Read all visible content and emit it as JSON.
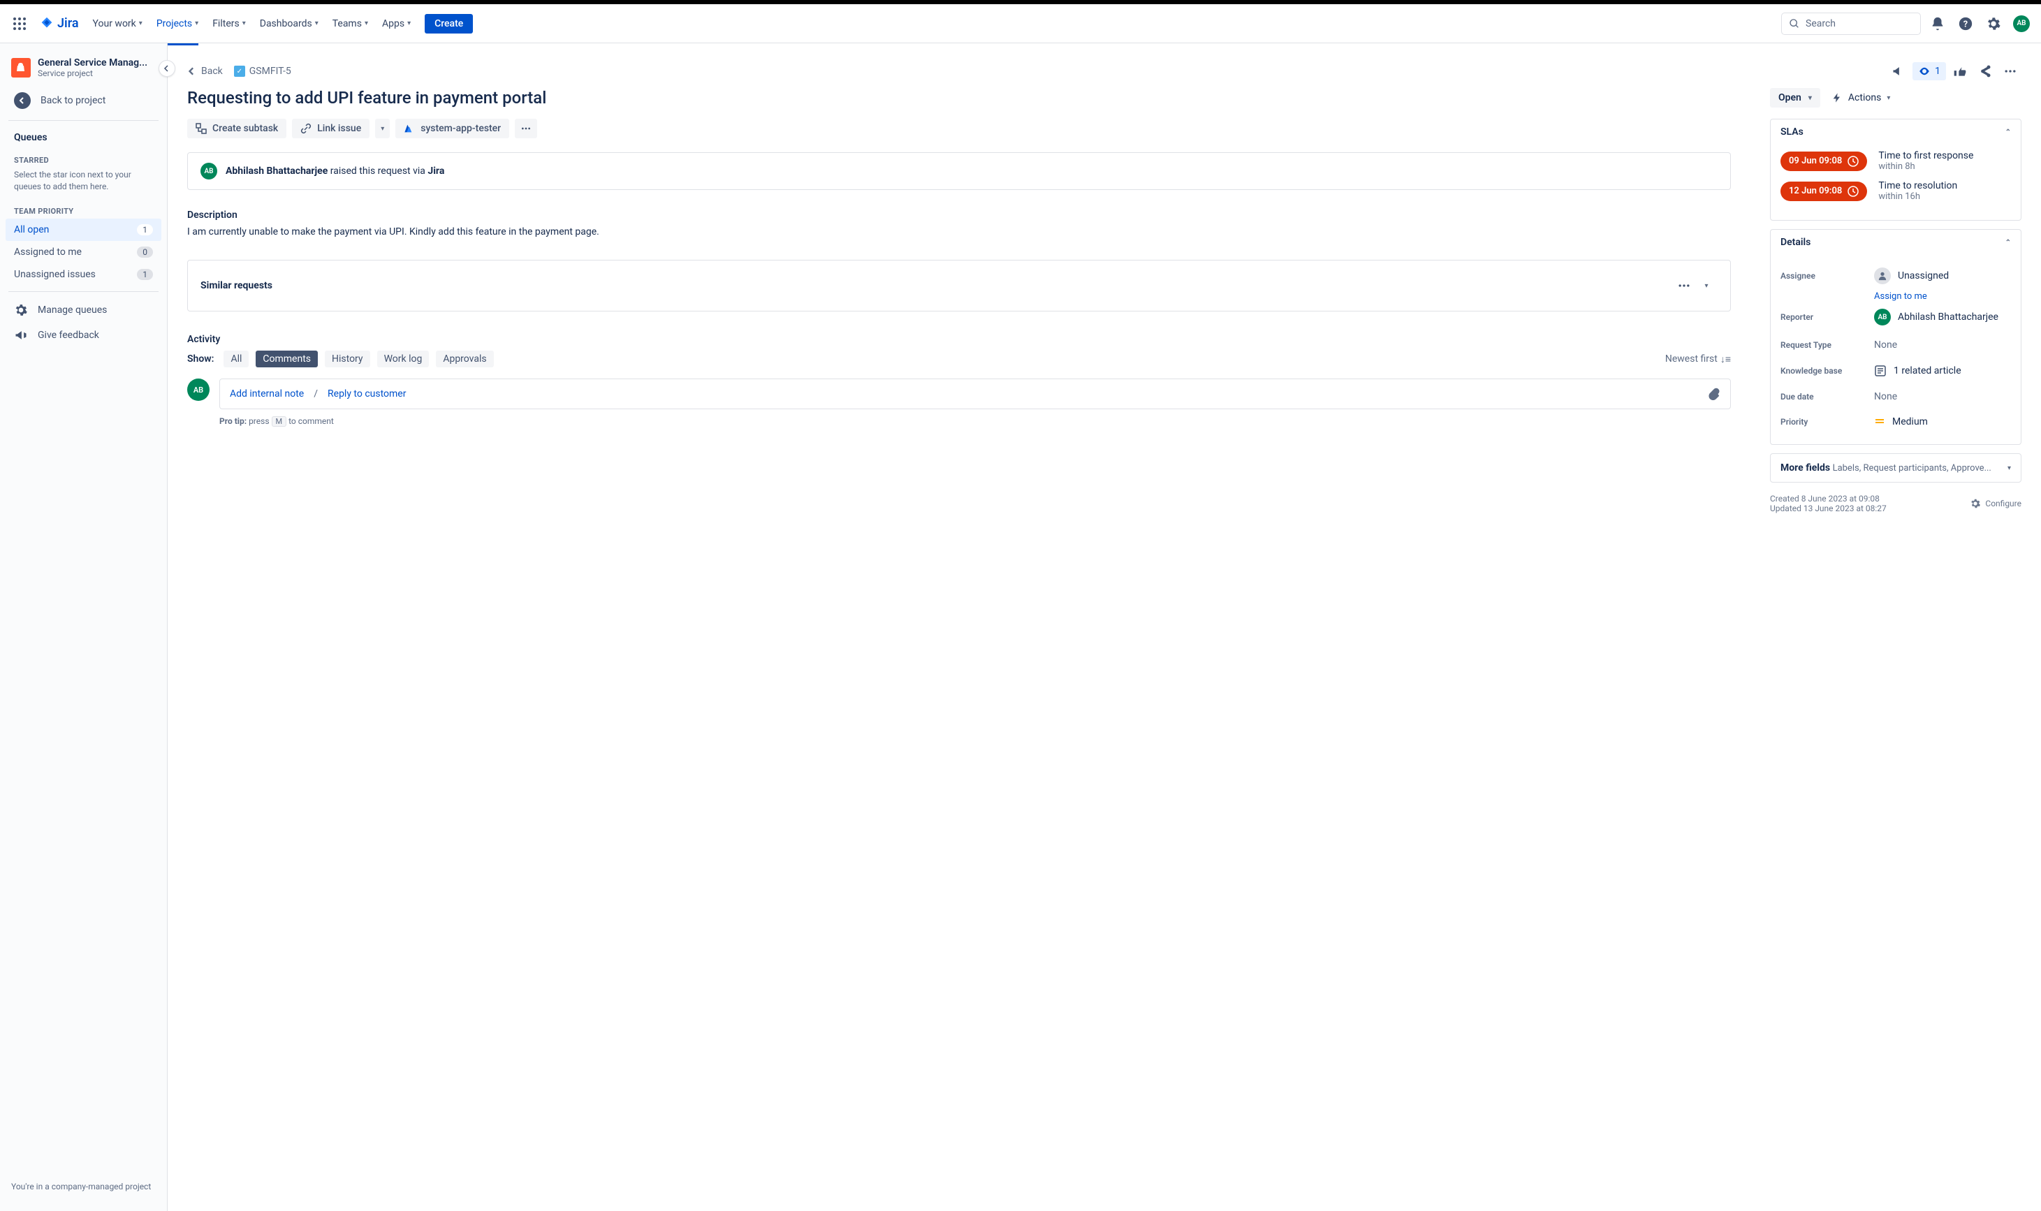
{
  "topbar": {
    "logo": "Jira",
    "nav": [
      {
        "label": "Your work"
      },
      {
        "label": "Projects"
      },
      {
        "label": "Filters"
      },
      {
        "label": "Dashboards"
      },
      {
        "label": "Teams"
      },
      {
        "label": "Apps"
      }
    ],
    "create": "Create",
    "search_placeholder": "Search",
    "avatar": "AB"
  },
  "sidebar": {
    "project_name": "General Service Manag...",
    "project_type": "Service project",
    "back_to_project": "Back to project",
    "queues_title": "Queues",
    "starred_title": "STARRED",
    "starred_help": "Select the star icon next to your queues to add them here.",
    "team_priority_title": "TEAM PRIORITY",
    "queues": [
      {
        "label": "All open",
        "count": "1"
      },
      {
        "label": "Assigned to me",
        "count": "0"
      },
      {
        "label": "Unassigned issues",
        "count": "1"
      }
    ],
    "manage_queues": "Manage queues",
    "give_feedback": "Give feedback",
    "footer": "You're in a company-managed project"
  },
  "breadcrumb": {
    "back": "Back",
    "key": "GSMFIT-5",
    "watch_count": "1"
  },
  "issue": {
    "title": "Requesting to add UPI feature in payment portal",
    "create_subtask": "Create subtask",
    "link_issue": "Link issue",
    "system_app": "system-app-tester",
    "reporter_name": "Abhilash Bhattacharjee",
    "raised_text": "raised this request via",
    "raised_via": "Jira",
    "description_label": "Description",
    "description_text": "I am currently unable to make the payment via UPI. Kindly add this feature in the payment page.",
    "similar_requests": "Similar requests",
    "activity_label": "Activity",
    "show_label": "Show:",
    "tabs": {
      "all": "All",
      "comments": "Comments",
      "history": "History",
      "worklog": "Work log",
      "approvals": "Approvals"
    },
    "sort": "Newest first",
    "comment": {
      "avatar": "AB",
      "add_note": "Add internal note",
      "reply": "Reply to customer",
      "protip_pre": "Pro tip:",
      "protip_press": "press",
      "protip_key": "M",
      "protip_post": "to comment"
    }
  },
  "right": {
    "status": "Open",
    "actions": "Actions",
    "slas": {
      "title": "SLAs",
      "items": [
        {
          "time": "09 Jun 09:08",
          "label": "Time to first response",
          "within": "within 8h"
        },
        {
          "time": "12 Jun 09:08",
          "label": "Time to resolution",
          "within": "within 16h"
        }
      ]
    },
    "details": {
      "title": "Details",
      "assignee_label": "Assignee",
      "assignee_value": "Unassigned",
      "assign_to_me": "Assign to me",
      "reporter_label": "Reporter",
      "reporter_value": "Abhilash Bhattacharjee",
      "reporter_avatar": "AB",
      "request_type_label": "Request Type",
      "request_type_value": "None",
      "kb_label": "Knowledge base",
      "kb_value": "1 related article",
      "due_label": "Due date",
      "due_value": "None",
      "priority_label": "Priority",
      "priority_value": "Medium"
    },
    "more_fields": {
      "title": "More fields",
      "sub": "Labels, Request participants, Approve..."
    },
    "created": "Created 8 June 2023 at 09:08",
    "updated": "Updated 13 June 2023 at 08:27",
    "configure": "Configure"
  }
}
